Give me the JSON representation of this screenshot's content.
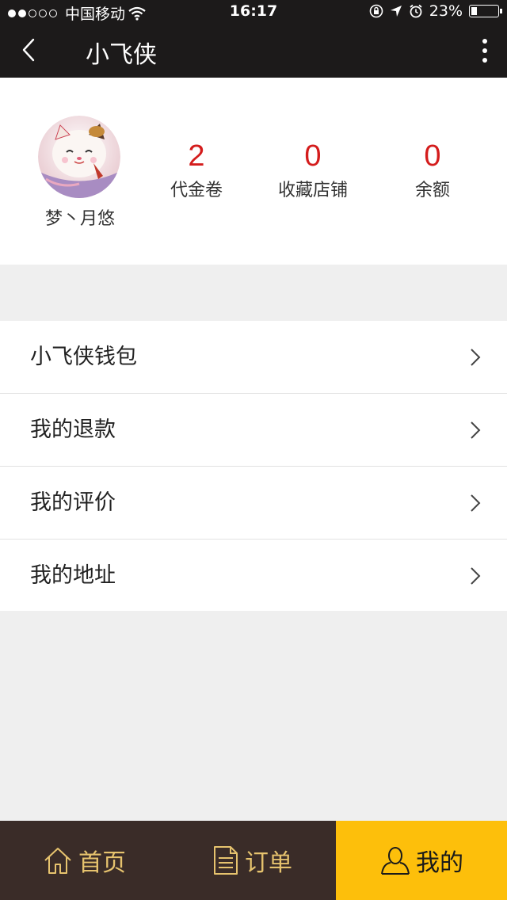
{
  "status_bar": {
    "carrier": "中国移动",
    "time": "16:17",
    "battery": "23%",
    "battery_level": 0.23
  },
  "nav": {
    "title": "小飞侠",
    "back_icon": "chevron-left-icon",
    "more_icon": "vertical-dots-icon"
  },
  "profile": {
    "username": "梦丶月悠",
    "stats": [
      {
        "value": "2",
        "label": "代金卷"
      },
      {
        "value": "0",
        "label": "收藏店铺"
      },
      {
        "value": "0",
        "label": "余额"
      }
    ]
  },
  "menu": {
    "items": [
      {
        "label": "小飞侠钱包"
      },
      {
        "label": "我的退款"
      },
      {
        "label": "我的评价"
      },
      {
        "label": "我的地址"
      }
    ]
  },
  "tabs": [
    {
      "label": "首页",
      "icon": "home-icon"
    },
    {
      "label": "订单",
      "icon": "document-icon"
    },
    {
      "label": "我的",
      "icon": "user-icon"
    }
  ],
  "colors": {
    "header_bg": "#1c1a1a",
    "stat_value": "#d41c1c",
    "tab_bg": "#3a2c28",
    "tab_active_bg": "#fdbf0b",
    "tab_text": "#e6c36e"
  }
}
